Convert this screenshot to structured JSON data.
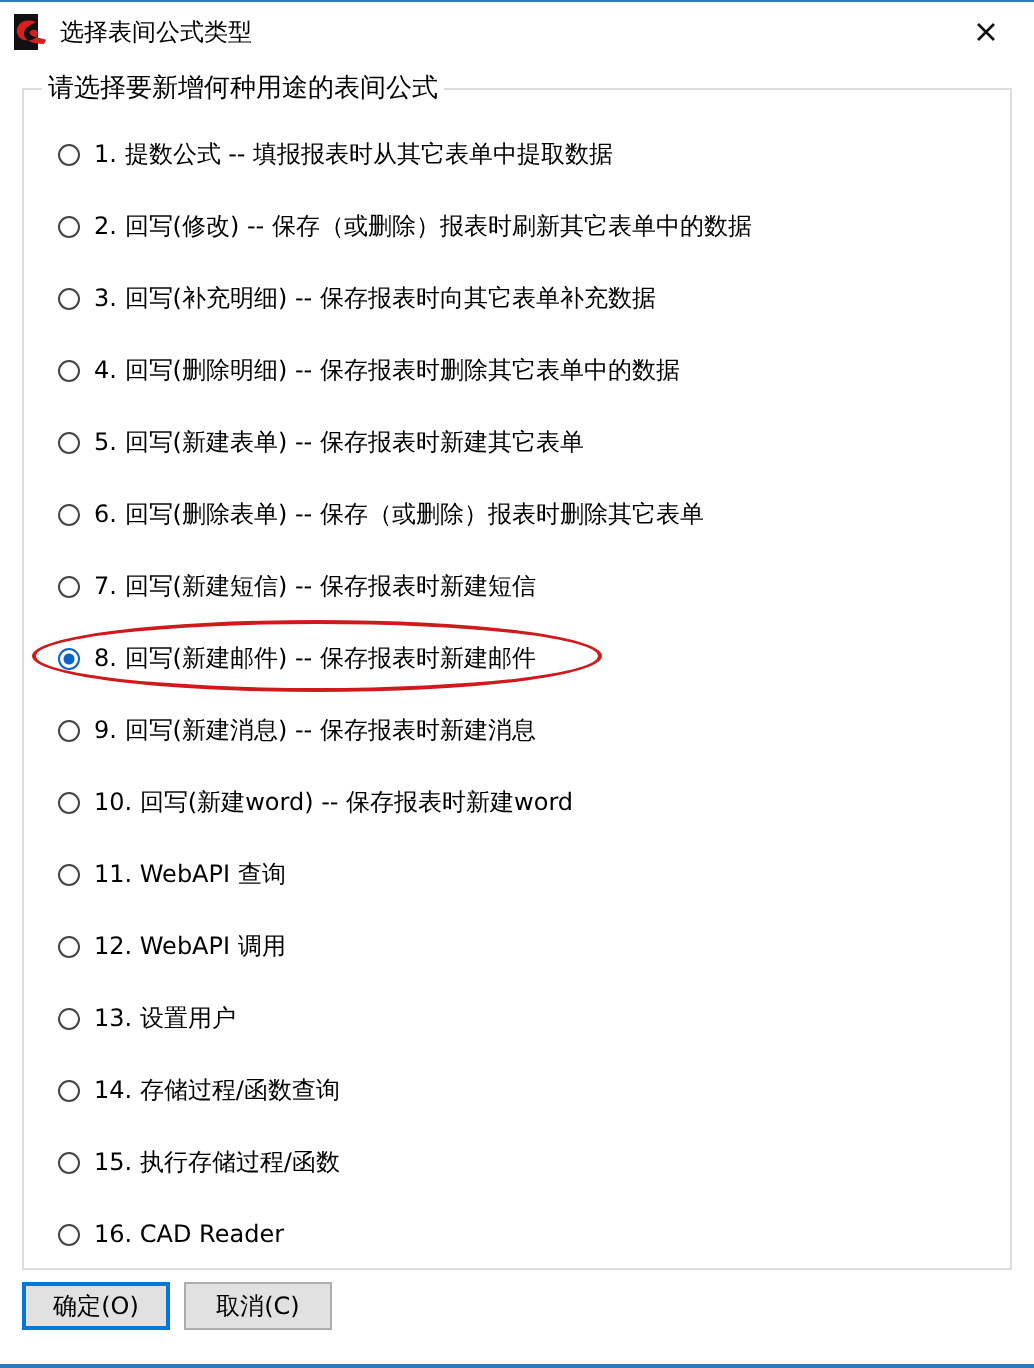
{
  "window": {
    "title": "选择表间公式类型"
  },
  "group": {
    "title": "请选择要新增何种用途的表间公式"
  },
  "options": [
    {
      "label": "1. 提数公式 -- 填报报表时从其它表单中提取数据",
      "selected": false,
      "circled": false
    },
    {
      "label": "2. 回写(修改) -- 保存（或删除）报表时刷新其它表单中的数据",
      "selected": false,
      "circled": false
    },
    {
      "label": "3. 回写(补充明细) -- 保存报表时向其它表单补充数据",
      "selected": false,
      "circled": false
    },
    {
      "label": "4. 回写(删除明细) -- 保存报表时删除其它表单中的数据",
      "selected": false,
      "circled": false
    },
    {
      "label": "5. 回写(新建表单) -- 保存报表时新建其它表单",
      "selected": false,
      "circled": false
    },
    {
      "label": "6. 回写(删除表单) -- 保存（或删除）报表时删除其它表单",
      "selected": false,
      "circled": false
    },
    {
      "label": "7. 回写(新建短信) -- 保存报表时新建短信",
      "selected": false,
      "circled": false
    },
    {
      "label": "8. 回写(新建邮件) -- 保存报表时新建邮件",
      "selected": true,
      "circled": true
    },
    {
      "label": "9. 回写(新建消息) -- 保存报表时新建消息",
      "selected": false,
      "circled": false
    },
    {
      "label": "10. 回写(新建word) -- 保存报表时新建word",
      "selected": false,
      "circled": false
    },
    {
      "label": "11. WebAPI 查询",
      "selected": false,
      "circled": false
    },
    {
      "label": "12. WebAPI 调用",
      "selected": false,
      "circled": false
    },
    {
      "label": "13. 设置用户",
      "selected": false,
      "circled": false
    },
    {
      "label": "14. 存储过程/函数查询",
      "selected": false,
      "circled": false
    },
    {
      "label": "15. 执行存储过程/函数",
      "selected": false,
      "circled": false
    },
    {
      "label": "16. CAD Reader",
      "selected": false,
      "circled": false
    }
  ],
  "buttons": [
    {
      "label": "确定(O)",
      "default": true
    },
    {
      "label": "取消(C)",
      "default": false
    }
  ]
}
